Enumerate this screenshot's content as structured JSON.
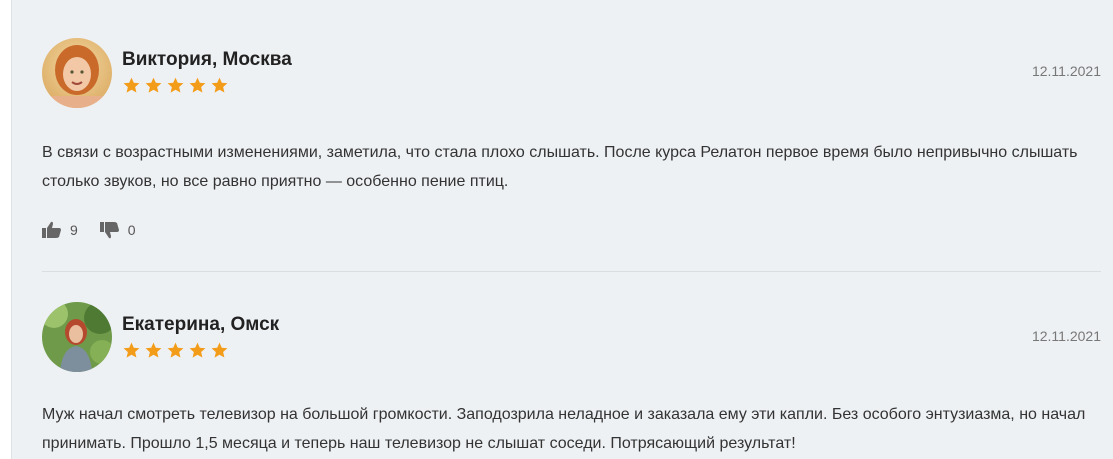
{
  "reviews": [
    {
      "author": "Виктория, Москва",
      "rating": 5,
      "date": "12.11.2021",
      "text": "В связи с возрастными изменениями, заметила, что стала плохо слышать. После курса Релатон первое время было непривычно слышать столько звуков, но все равно приятно — особенно пение птиц.",
      "likes": "9",
      "dislikes": "0"
    },
    {
      "author": "Екатерина, Омск",
      "rating": 5,
      "date": "12.11.2021",
      "text": "Муж начал смотреть телевизор на большой громкости. Заподозрила неладное и заказала ему эти капли. Без особого энтузиазма, но начал принимать. Прошло 1,5 месяца и теперь наш телевизор не слышат соседи. Потрясающий результат!"
    }
  ],
  "colors": {
    "star": "#f39c1a",
    "background": "#eef1f4"
  },
  "icons": {
    "like": "thumbs-up-icon",
    "dislike": "thumbs-down-icon"
  }
}
